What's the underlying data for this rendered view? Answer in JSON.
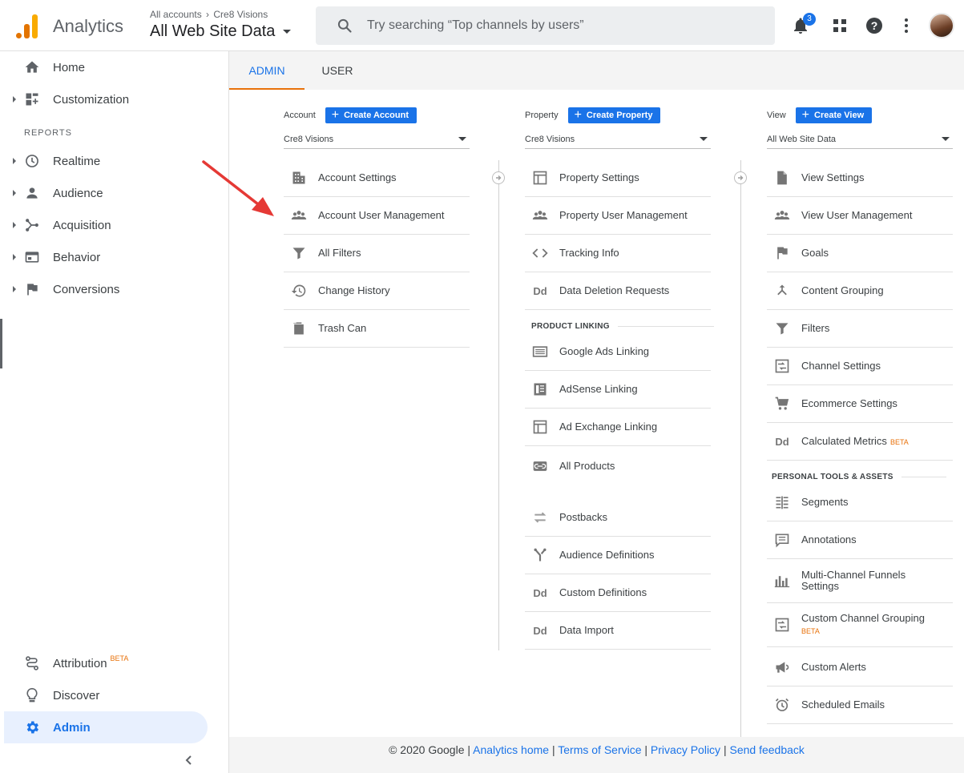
{
  "header": {
    "app_name": "Analytics",
    "crumb_root": "All accounts",
    "crumb_account": "Cre8 Visions",
    "view_name": "All Web Site Data",
    "search_placeholder": "Try searching “Top channels by users”",
    "notification_count": "3"
  },
  "sidebar": {
    "top_items": [
      {
        "label": "Home",
        "icon": "home-icon"
      },
      {
        "label": "Customization",
        "icon": "dashboard-icon"
      }
    ],
    "section_label": "REPORTS",
    "report_items": [
      {
        "label": "Realtime",
        "icon": "clock-icon"
      },
      {
        "label": "Audience",
        "icon": "person-icon"
      },
      {
        "label": "Acquisition",
        "icon": "acquisition-icon"
      },
      {
        "label": "Behavior",
        "icon": "behavior-icon"
      },
      {
        "label": "Conversions",
        "icon": "flag-icon"
      }
    ],
    "bottom_items": [
      {
        "label": "Attribution",
        "badge": "BETA",
        "icon": "attribution-icon"
      },
      {
        "label": "Discover",
        "icon": "lightbulb-icon"
      },
      {
        "label": "Admin",
        "icon": "gear-icon",
        "active": true
      }
    ]
  },
  "tabs": {
    "admin": "ADMIN",
    "user": "USER",
    "active": "ADMIN"
  },
  "account": {
    "heading": "Account",
    "create_label": "Create Account",
    "selected": "Cre8 Visions",
    "items": [
      {
        "label": "Account Settings",
        "icon": "building-icon"
      },
      {
        "label": "Account User Management",
        "icon": "people-icon"
      },
      {
        "label": "All Filters",
        "icon": "filter-icon"
      },
      {
        "label": "Change History",
        "icon": "history-icon"
      },
      {
        "label": "Trash Can",
        "icon": "trash-icon"
      }
    ]
  },
  "property": {
    "heading": "Property",
    "create_label": "Create Property",
    "selected": "Cre8 Visions",
    "items": [
      {
        "label": "Property Settings",
        "icon": "window-icon"
      },
      {
        "label": "Property User Management",
        "icon": "people-icon"
      },
      {
        "label": "Tracking Info",
        "icon": "code-icon"
      },
      {
        "label": "Data Deletion Requests",
        "icon": "dd-icon"
      }
    ],
    "linking_heading": "PRODUCT LINKING",
    "linking_items": [
      {
        "label": "Google Ads Linking",
        "icon": "ads-icon"
      },
      {
        "label": "AdSense Linking",
        "icon": "adsense-icon"
      },
      {
        "label": "Ad Exchange Linking",
        "icon": "window-icon"
      },
      {
        "label": "All Products",
        "icon": "link-icon"
      }
    ],
    "other_items": [
      {
        "label": "Postbacks",
        "icon": "swap-icon"
      },
      {
        "label": "Audience Definitions",
        "icon": "fork-icon"
      },
      {
        "label": "Custom Definitions",
        "icon": "dd-icon"
      },
      {
        "label": "Data Import",
        "icon": "dd-icon"
      }
    ]
  },
  "view": {
    "heading": "View",
    "create_label": "Create View",
    "selected": "All Web Site Data",
    "items": [
      {
        "label": "View Settings",
        "icon": "document-icon"
      },
      {
        "label": "View User Management",
        "icon": "people-icon"
      },
      {
        "label": "Goals",
        "icon": "flag-icon"
      },
      {
        "label": "Content Grouping",
        "icon": "merge-icon"
      },
      {
        "label": "Filters",
        "icon": "filter-icon"
      },
      {
        "label": "Channel Settings",
        "icon": "channel-icon"
      },
      {
        "label": "Ecommerce Settings",
        "icon": "cart-icon"
      },
      {
        "label": "Calculated Metrics",
        "badge": "BETA",
        "icon": "dd-icon"
      }
    ],
    "personal_heading": "PERSONAL TOOLS & ASSETS",
    "personal_items": [
      {
        "label": "Segments",
        "icon": "segments-icon"
      },
      {
        "label": "Annotations",
        "icon": "comment-icon"
      },
      {
        "label": "Multi-Channel Funnels Settings",
        "icon": "bars-icon"
      },
      {
        "label": "Custom Channel Grouping",
        "badge": "BETA",
        "icon": "channel-icon"
      },
      {
        "label": "Custom Alerts",
        "icon": "megaphone-icon"
      },
      {
        "label": "Scheduled Emails",
        "icon": "alarm-icon"
      }
    ]
  },
  "footer": {
    "copyright": "© 2020 Google |",
    "links": [
      "Analytics home",
      "Terms of Service",
      "Privacy Policy",
      "Send feedback"
    ],
    "separator": "|"
  },
  "colors": {
    "accent": "#1a73e8",
    "tab_underline": "#e8710a",
    "beta": "#e8710a",
    "annotation_arrow": "#e53935"
  }
}
